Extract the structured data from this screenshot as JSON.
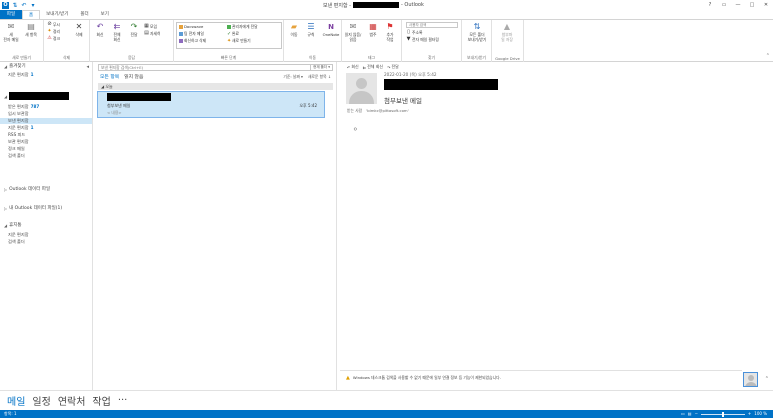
{
  "window": {
    "title_prefix": "보낸 편지함 -",
    "title_suffix": "- Outlook",
    "controls": [
      "?",
      "▭",
      "—",
      "□",
      "✕"
    ]
  },
  "quick_access": [
    "↶",
    "▾"
  ],
  "tabs": [
    "파일",
    "홈",
    "보내기/받기",
    "폴더",
    "보기"
  ],
  "ribbon": {
    "groups": {
      "new": "새로 만들기",
      "delete": "삭제",
      "respond": "응답",
      "quick_steps": "빠른 단계",
      "move": "이동",
      "tags": "태그",
      "find": "찾기",
      "send_receive": "보내기/받기",
      "google_drive": "Google Drive"
    },
    "new_email": "새\n전자 메일",
    "new_items": "새 항목",
    "ignore": "무시",
    "cleanup": "정리",
    "junk": "정크",
    "delete": "삭제",
    "reply": "회신",
    "reply_all": "전체\n회신",
    "forward": "전달",
    "meeting": "모임",
    "more": "자세히",
    "quick_steps": [
      "Docswave",
      "팀 전자 메일",
      "회신하고 삭제",
      "관리자에게 전달",
      "완료",
      "새로 만들기"
    ],
    "move": "이동",
    "rules": "규칙",
    "onenote": "OneNote",
    "unread_read": "읽지 않음/\n읽음",
    "categorize": "범주",
    "follow_up": "추가\n작업",
    "search_people_placeholder": "사용자 검색",
    "address_book": "주소록",
    "filter_email": "전자 메일 필터링",
    "send_receive_all": "모든 폴더\n보내기/받기",
    "save_to_drive": "첨부파\n일 저장"
  },
  "folder_pane": {
    "favorites": "즐겨찾기",
    "favorites_items": [
      {
        "label": "지운 편지함",
        "count": "1"
      }
    ],
    "mailbox_items": [
      {
        "label": "받은 편지함",
        "count": "787"
      },
      {
        "label": "임시 보관함",
        "count": ""
      },
      {
        "label": "보낸 편지함",
        "count": ""
      },
      {
        "label": "지운 편지함",
        "count": "1"
      },
      {
        "label": "RSS 피드",
        "count": ""
      },
      {
        "label": "보관 편지함",
        "count": ""
      },
      {
        "label": "정크 메일",
        "count": ""
      },
      {
        "label": "검색 폴더",
        "count": ""
      }
    ],
    "outlook_data": "Outlook 데이터 파일",
    "my_outlook_data": "내 Outlook 데이터 파일(1)",
    "trash": "휴지통",
    "trash_items": [
      {
        "label": "지운 편지함"
      },
      {
        "label": "검색 폴더"
      }
    ]
  },
  "message_list": {
    "search_placeholder": "보낸 편지함 검색(Ctrl+E)",
    "search_scope": "현재 폴더 ▾",
    "filter_all": "모든 항목",
    "filter_unread": "읽지 않음",
    "sort_by": "기준: 날짜 ▾",
    "sort_order": "새로운 항목 ↓",
    "group_header": "오늘",
    "message": {
      "subject": "첨부보낸 메일",
      "preview": "< 내용>",
      "time": "오후 5:42"
    }
  },
  "reading_pane": {
    "actions": [
      "회신",
      "전체 회신",
      "전달"
    ],
    "date": "2022-01-20 (목) 오후 5:42",
    "subject": "첨부보낸 메일",
    "to_label": "받는 사람",
    "to_value": "'bimkc@pittasoft.com'",
    "body": "ㅇ",
    "infobar": "Windows 데스크톱 검색을 사용할 수 없기 때문에 일부 연결 정보 등 기능이 제한되었습니다."
  },
  "bottom_nav": [
    "메일",
    "일정",
    "연락처",
    "작업",
    "···"
  ],
  "status": {
    "items": "항목: 1",
    "zoom": "100 %"
  }
}
